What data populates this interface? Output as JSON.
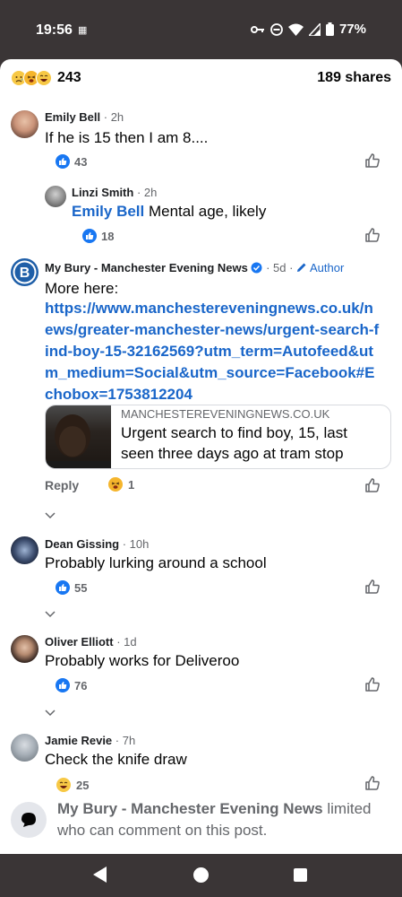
{
  "status": {
    "time": "19:56",
    "battery": "77%"
  },
  "header": {
    "reaction_count": "243",
    "shares": "189 shares"
  },
  "comments": [
    {
      "name": "Emily Bell",
      "time": "· 2h",
      "text": "If he is 15 then I am 8....",
      "likes": "43"
    },
    {
      "name": "Linzi Smith",
      "time": "· 2h",
      "mention": "Emily Bell",
      "text": " Mental age, likely",
      "likes": "18"
    },
    {
      "name": "My Bury - Manchester Evening News",
      "time": "· 5d ·",
      "author_badge": "Author",
      "text": "More here:",
      "link": "https://www.manchestereveningnews.co.uk/news/greater-manchester-news/urgent-search-find-boy-15-32162569?utm_term=Autofeed&utm_medium=Social&utm_source=Facebook#Echobox=1753812204",
      "link_preview": {
        "domain": "MANCHESTEREVENINGNEWS.CO.UK",
        "title": "Urgent search to find boy, 15, last seen three days ago at tram stop"
      },
      "reply_label": "Reply",
      "reactions": "1"
    },
    {
      "name": "Dean Gissing",
      "time": "· 10h",
      "text": "Probably lurking around a school",
      "likes": "55"
    },
    {
      "name": "Oliver Elliott",
      "time": "· 1d",
      "text": "Probably works for Deliveroo",
      "likes": "76"
    },
    {
      "name": "Jamie Revie",
      "time": "· 7h",
      "text": "Check the knife draw",
      "likes": "25"
    }
  ],
  "footer": {
    "name": "My Bury - Manchester Evening News",
    "text": " limited who can comment on this post."
  },
  "colors": {
    "link": "#1a66c9",
    "like_blue": "#1877f2",
    "muted": "#65676b"
  }
}
